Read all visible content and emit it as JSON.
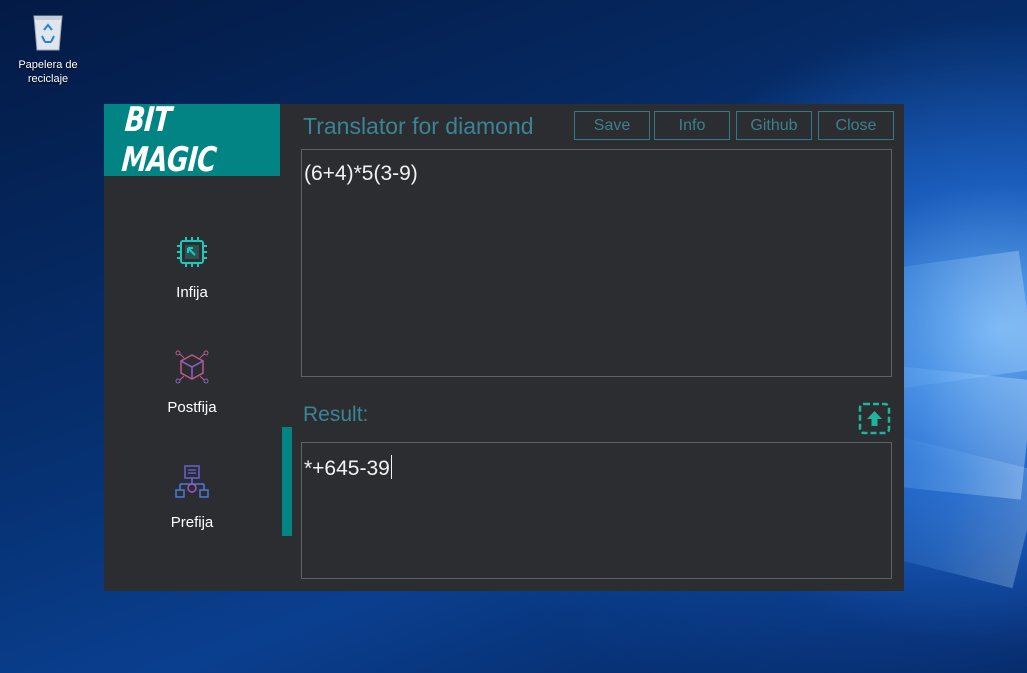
{
  "desktop": {
    "recycle_bin_label": "Papelera de reciclaje"
  },
  "app": {
    "logo_text": "BIT MAGIC",
    "title": "Translator for diamond",
    "toolbar": {
      "save_label": "Save",
      "info_label": "Info",
      "github_label": "Github",
      "close_label": "Close"
    },
    "nav": {
      "items": [
        {
          "label": "Infija",
          "icon": "cpu-chip-icon",
          "color": "#1fc7b8"
        },
        {
          "label": "Postfija",
          "icon": "network-cube-icon",
          "color": "#c0578c"
        },
        {
          "label": "Prefija",
          "icon": "document-flow-icon",
          "color": "#6b5fd6"
        }
      ],
      "active_index": 2
    },
    "input_expression": "(6+4)*5(3-9)",
    "result_label": "Result:",
    "result_value": "*+645-39",
    "colors": {
      "accent": "#018483",
      "panel": "#2b2d31",
      "label": "#3b8494"
    }
  }
}
